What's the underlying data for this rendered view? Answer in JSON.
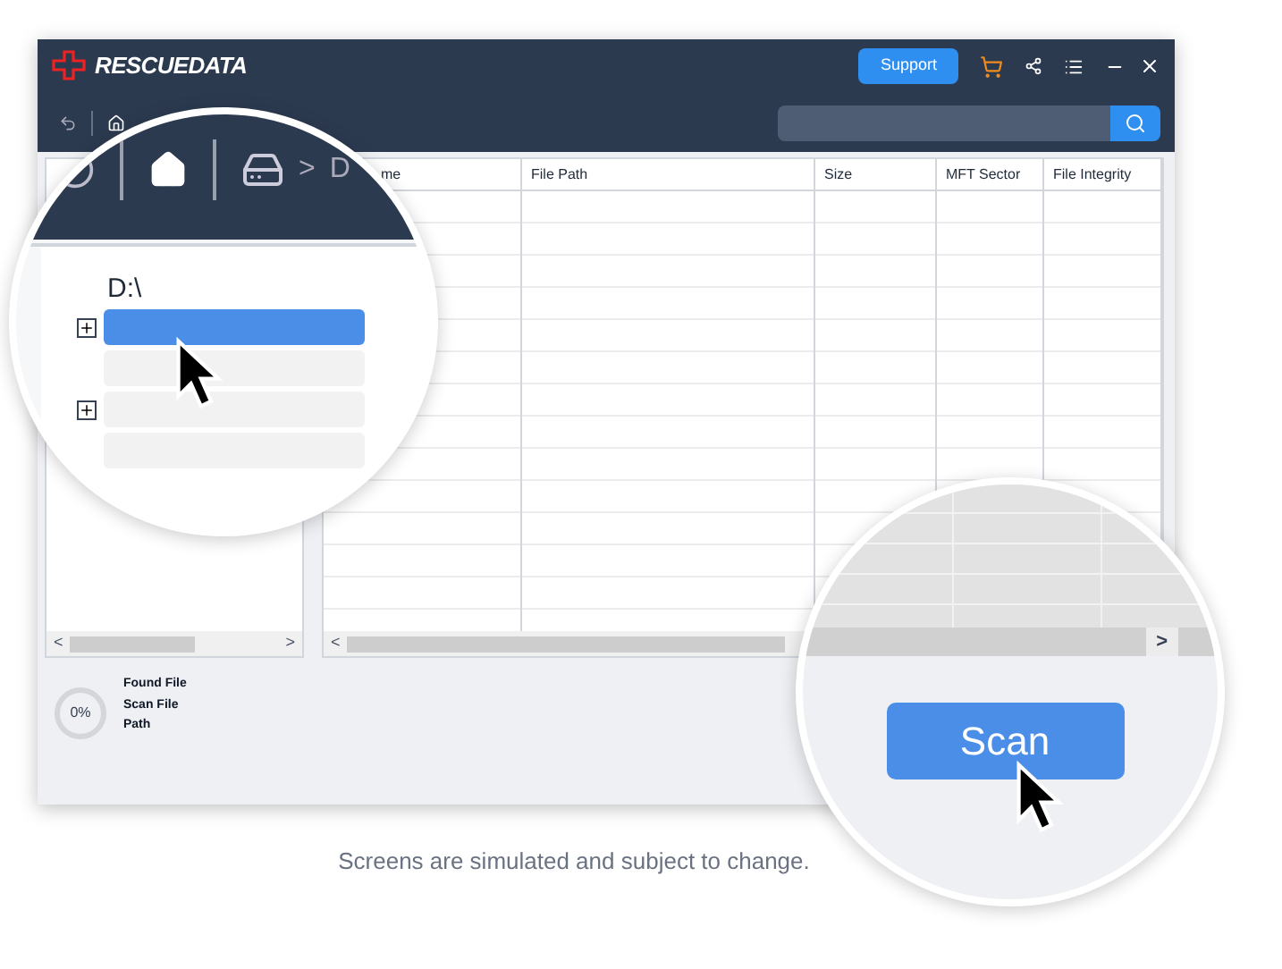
{
  "logo": "RESCUEDATA",
  "header": {
    "support_button": "Support"
  },
  "breadcrumb": {
    "separator": ">",
    "drive": "D"
  },
  "table": {
    "columns": [
      "me",
      "File Path",
      "Size",
      "MFT Sector",
      "File Integrity"
    ]
  },
  "tree": {
    "root": "D:\\",
    "items": [
      {
        "selected": true,
        "expandable": true
      },
      {
        "selected": false,
        "expandable": false
      },
      {
        "selected": false,
        "expandable": true
      },
      {
        "selected": false,
        "expandable": false
      }
    ]
  },
  "scrollbar": {
    "left": "<",
    "right": ">"
  },
  "progress": {
    "reading": "0%",
    "level": 0,
    "labels": [
      "Found File",
      "Scan File",
      "Path"
    ]
  },
  "scan_button": "Scan",
  "caption": "Screens are simulated and subject to change."
}
